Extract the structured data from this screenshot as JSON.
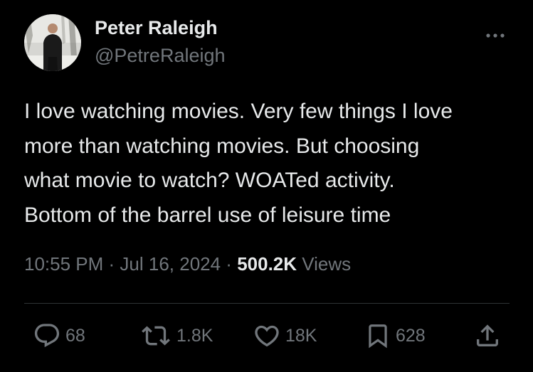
{
  "author": {
    "display_name": "Peter Raleigh",
    "handle": "@PetreRaleigh"
  },
  "tweet": {
    "lines": [
      "I love watching movies. Very few things I love",
      "more than watching movies. But choosing",
      "what movie to watch? WOATed activity.",
      "Bottom of the barrel use of leisure time"
    ]
  },
  "meta": {
    "time": "10:55 PM",
    "separator": " · ",
    "date": "Jul 16, 2024",
    "views_count": "500.2K",
    "views_label": "Views"
  },
  "actions": {
    "replies": "68",
    "reposts": "1.8K",
    "likes": "18K",
    "bookmarks": "628"
  },
  "colors": {
    "background": "#000000",
    "primary_text": "#e7e9ea",
    "secondary_text": "#71767b",
    "divider": "#2f3336"
  },
  "icons": {
    "more": "more-horizontal-icon",
    "reply": "reply-icon",
    "repost": "repost-icon",
    "like": "heart-icon",
    "bookmark": "bookmark-icon",
    "share": "share-icon"
  }
}
